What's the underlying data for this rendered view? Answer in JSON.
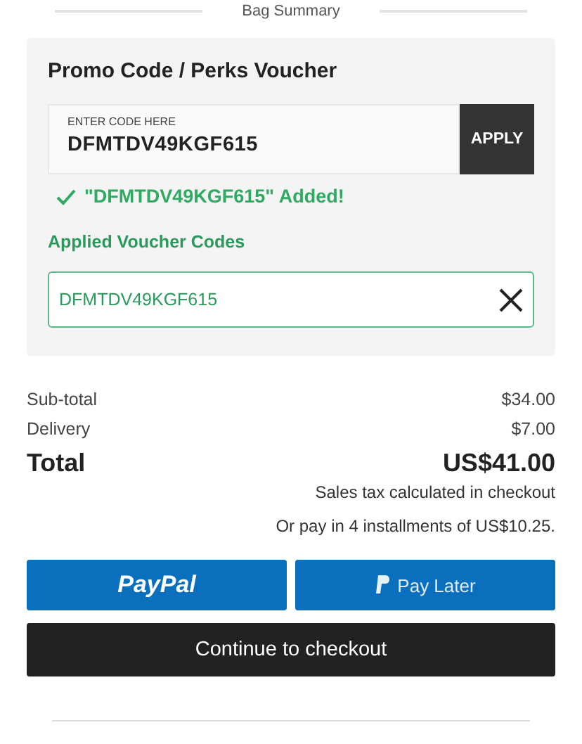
{
  "section_title": "Bag Summary",
  "promo": {
    "title": "Promo Code / Perks Voucher",
    "field_label": "ENTER CODE HERE",
    "value": "DFMTDV49KGF615",
    "apply_button": "APPLY",
    "success_message": "\"DFMTDV49KGF615\" Added!",
    "applied_title": "Applied Voucher Codes",
    "applied_codes": [
      {
        "code": "DFMTDV49KGF615"
      }
    ]
  },
  "summary": [
    {
      "label": "Sub-total",
      "value": "$34.00",
      "kind": "line"
    },
    {
      "label": "Delivery",
      "value": "$7.00",
      "kind": "line"
    },
    {
      "label": "Total",
      "value": "US$41.00",
      "kind": "total"
    }
  ],
  "tax_note": "Sales tax calculated in checkout",
  "installments_note": "Or pay in 4 installments of US$10.25.",
  "paypal_button": "PayPal",
  "pay_later_button": "Pay Later",
  "checkout_button": "Continue to checkout"
}
